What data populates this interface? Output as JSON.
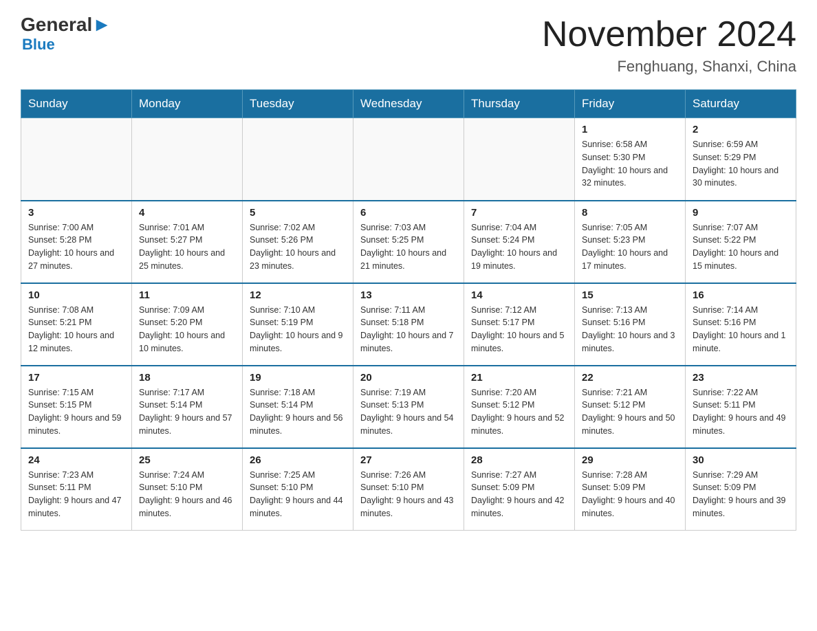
{
  "header": {
    "logo_general": "General",
    "logo_blue": "Blue",
    "month_title": "November 2024",
    "location": "Fenghuang, Shanxi, China"
  },
  "weekdays": [
    "Sunday",
    "Monday",
    "Tuesday",
    "Wednesday",
    "Thursday",
    "Friday",
    "Saturday"
  ],
  "weeks": [
    [
      {
        "day": "",
        "info": ""
      },
      {
        "day": "",
        "info": ""
      },
      {
        "day": "",
        "info": ""
      },
      {
        "day": "",
        "info": ""
      },
      {
        "day": "",
        "info": ""
      },
      {
        "day": "1",
        "info": "Sunrise: 6:58 AM\nSunset: 5:30 PM\nDaylight: 10 hours and 32 minutes."
      },
      {
        "day": "2",
        "info": "Sunrise: 6:59 AM\nSunset: 5:29 PM\nDaylight: 10 hours and 30 minutes."
      }
    ],
    [
      {
        "day": "3",
        "info": "Sunrise: 7:00 AM\nSunset: 5:28 PM\nDaylight: 10 hours and 27 minutes."
      },
      {
        "day": "4",
        "info": "Sunrise: 7:01 AM\nSunset: 5:27 PM\nDaylight: 10 hours and 25 minutes."
      },
      {
        "day": "5",
        "info": "Sunrise: 7:02 AM\nSunset: 5:26 PM\nDaylight: 10 hours and 23 minutes."
      },
      {
        "day": "6",
        "info": "Sunrise: 7:03 AM\nSunset: 5:25 PM\nDaylight: 10 hours and 21 minutes."
      },
      {
        "day": "7",
        "info": "Sunrise: 7:04 AM\nSunset: 5:24 PM\nDaylight: 10 hours and 19 minutes."
      },
      {
        "day": "8",
        "info": "Sunrise: 7:05 AM\nSunset: 5:23 PM\nDaylight: 10 hours and 17 minutes."
      },
      {
        "day": "9",
        "info": "Sunrise: 7:07 AM\nSunset: 5:22 PM\nDaylight: 10 hours and 15 minutes."
      }
    ],
    [
      {
        "day": "10",
        "info": "Sunrise: 7:08 AM\nSunset: 5:21 PM\nDaylight: 10 hours and 12 minutes."
      },
      {
        "day": "11",
        "info": "Sunrise: 7:09 AM\nSunset: 5:20 PM\nDaylight: 10 hours and 10 minutes."
      },
      {
        "day": "12",
        "info": "Sunrise: 7:10 AM\nSunset: 5:19 PM\nDaylight: 10 hours and 9 minutes."
      },
      {
        "day": "13",
        "info": "Sunrise: 7:11 AM\nSunset: 5:18 PM\nDaylight: 10 hours and 7 minutes."
      },
      {
        "day": "14",
        "info": "Sunrise: 7:12 AM\nSunset: 5:17 PM\nDaylight: 10 hours and 5 minutes."
      },
      {
        "day": "15",
        "info": "Sunrise: 7:13 AM\nSunset: 5:16 PM\nDaylight: 10 hours and 3 minutes."
      },
      {
        "day": "16",
        "info": "Sunrise: 7:14 AM\nSunset: 5:16 PM\nDaylight: 10 hours and 1 minute."
      }
    ],
    [
      {
        "day": "17",
        "info": "Sunrise: 7:15 AM\nSunset: 5:15 PM\nDaylight: 9 hours and 59 minutes."
      },
      {
        "day": "18",
        "info": "Sunrise: 7:17 AM\nSunset: 5:14 PM\nDaylight: 9 hours and 57 minutes."
      },
      {
        "day": "19",
        "info": "Sunrise: 7:18 AM\nSunset: 5:14 PM\nDaylight: 9 hours and 56 minutes."
      },
      {
        "day": "20",
        "info": "Sunrise: 7:19 AM\nSunset: 5:13 PM\nDaylight: 9 hours and 54 minutes."
      },
      {
        "day": "21",
        "info": "Sunrise: 7:20 AM\nSunset: 5:12 PM\nDaylight: 9 hours and 52 minutes."
      },
      {
        "day": "22",
        "info": "Sunrise: 7:21 AM\nSunset: 5:12 PM\nDaylight: 9 hours and 50 minutes."
      },
      {
        "day": "23",
        "info": "Sunrise: 7:22 AM\nSunset: 5:11 PM\nDaylight: 9 hours and 49 minutes."
      }
    ],
    [
      {
        "day": "24",
        "info": "Sunrise: 7:23 AM\nSunset: 5:11 PM\nDaylight: 9 hours and 47 minutes."
      },
      {
        "day": "25",
        "info": "Sunrise: 7:24 AM\nSunset: 5:10 PM\nDaylight: 9 hours and 46 minutes."
      },
      {
        "day": "26",
        "info": "Sunrise: 7:25 AM\nSunset: 5:10 PM\nDaylight: 9 hours and 44 minutes."
      },
      {
        "day": "27",
        "info": "Sunrise: 7:26 AM\nSunset: 5:10 PM\nDaylight: 9 hours and 43 minutes."
      },
      {
        "day": "28",
        "info": "Sunrise: 7:27 AM\nSunset: 5:09 PM\nDaylight: 9 hours and 42 minutes."
      },
      {
        "day": "29",
        "info": "Sunrise: 7:28 AM\nSunset: 5:09 PM\nDaylight: 9 hours and 40 minutes."
      },
      {
        "day": "30",
        "info": "Sunrise: 7:29 AM\nSunset: 5:09 PM\nDaylight: 9 hours and 39 minutes."
      }
    ]
  ]
}
